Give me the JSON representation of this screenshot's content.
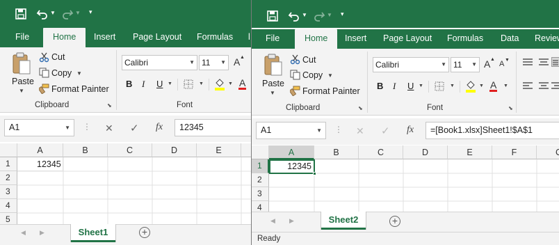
{
  "windows": [
    {
      "ribbon_tabs": [
        "File",
        "Home",
        "Insert",
        "Page Layout",
        "Formulas",
        "l"
      ],
      "active_tab": "Home",
      "clipboard": {
        "paste": "Paste",
        "cut": "Cut",
        "copy": "Copy",
        "format_painter": "Format Painter",
        "group_label": "Clipboard"
      },
      "font": {
        "name": "Calibri",
        "size": "11",
        "group_label": "Font",
        "bold": "B",
        "italic": "I",
        "underline": "U"
      },
      "namebox": "A1",
      "formula": "12345",
      "columns": [
        "A",
        "B",
        "C",
        "D",
        "E"
      ],
      "rows": [
        "1",
        "2",
        "3",
        "4",
        "5"
      ],
      "cells": {
        "A1": "12345"
      },
      "sheet_tab": "Sheet1"
    },
    {
      "ribbon_tabs": [
        "File",
        "Home",
        "Insert",
        "Page Layout",
        "Formulas",
        "Data",
        "Review"
      ],
      "active_tab": "Home",
      "clipboard": {
        "paste": "Paste",
        "cut": "Cut",
        "copy": "Copy",
        "format_painter": "Format Painter",
        "group_label": "Clipboard"
      },
      "font": {
        "name": "Calibri",
        "size": "11",
        "group_label": "Font",
        "bold": "B",
        "italic": "I",
        "underline": "U"
      },
      "namebox": "A1",
      "formula": "=[Book1.xlsx]Sheet1!$A$1",
      "columns": [
        "A",
        "B",
        "C",
        "D",
        "E",
        "F",
        "C"
      ],
      "rows": [
        "1",
        "2",
        "3",
        "4"
      ],
      "cells": {
        "A1": "12345"
      },
      "sheet_tab": "Sheet2",
      "status": "Ready"
    }
  ],
  "colors": {
    "brand": "#217346",
    "ribbon_bg": "#f3f3f3",
    "selected_cell_border": "#217346"
  },
  "glyphs": {
    "fx": "fx",
    "plus": "+",
    "cancel": "✕",
    "enter": "✓",
    "size_up": "A",
    "size_down": "A",
    "font_color": "A"
  }
}
